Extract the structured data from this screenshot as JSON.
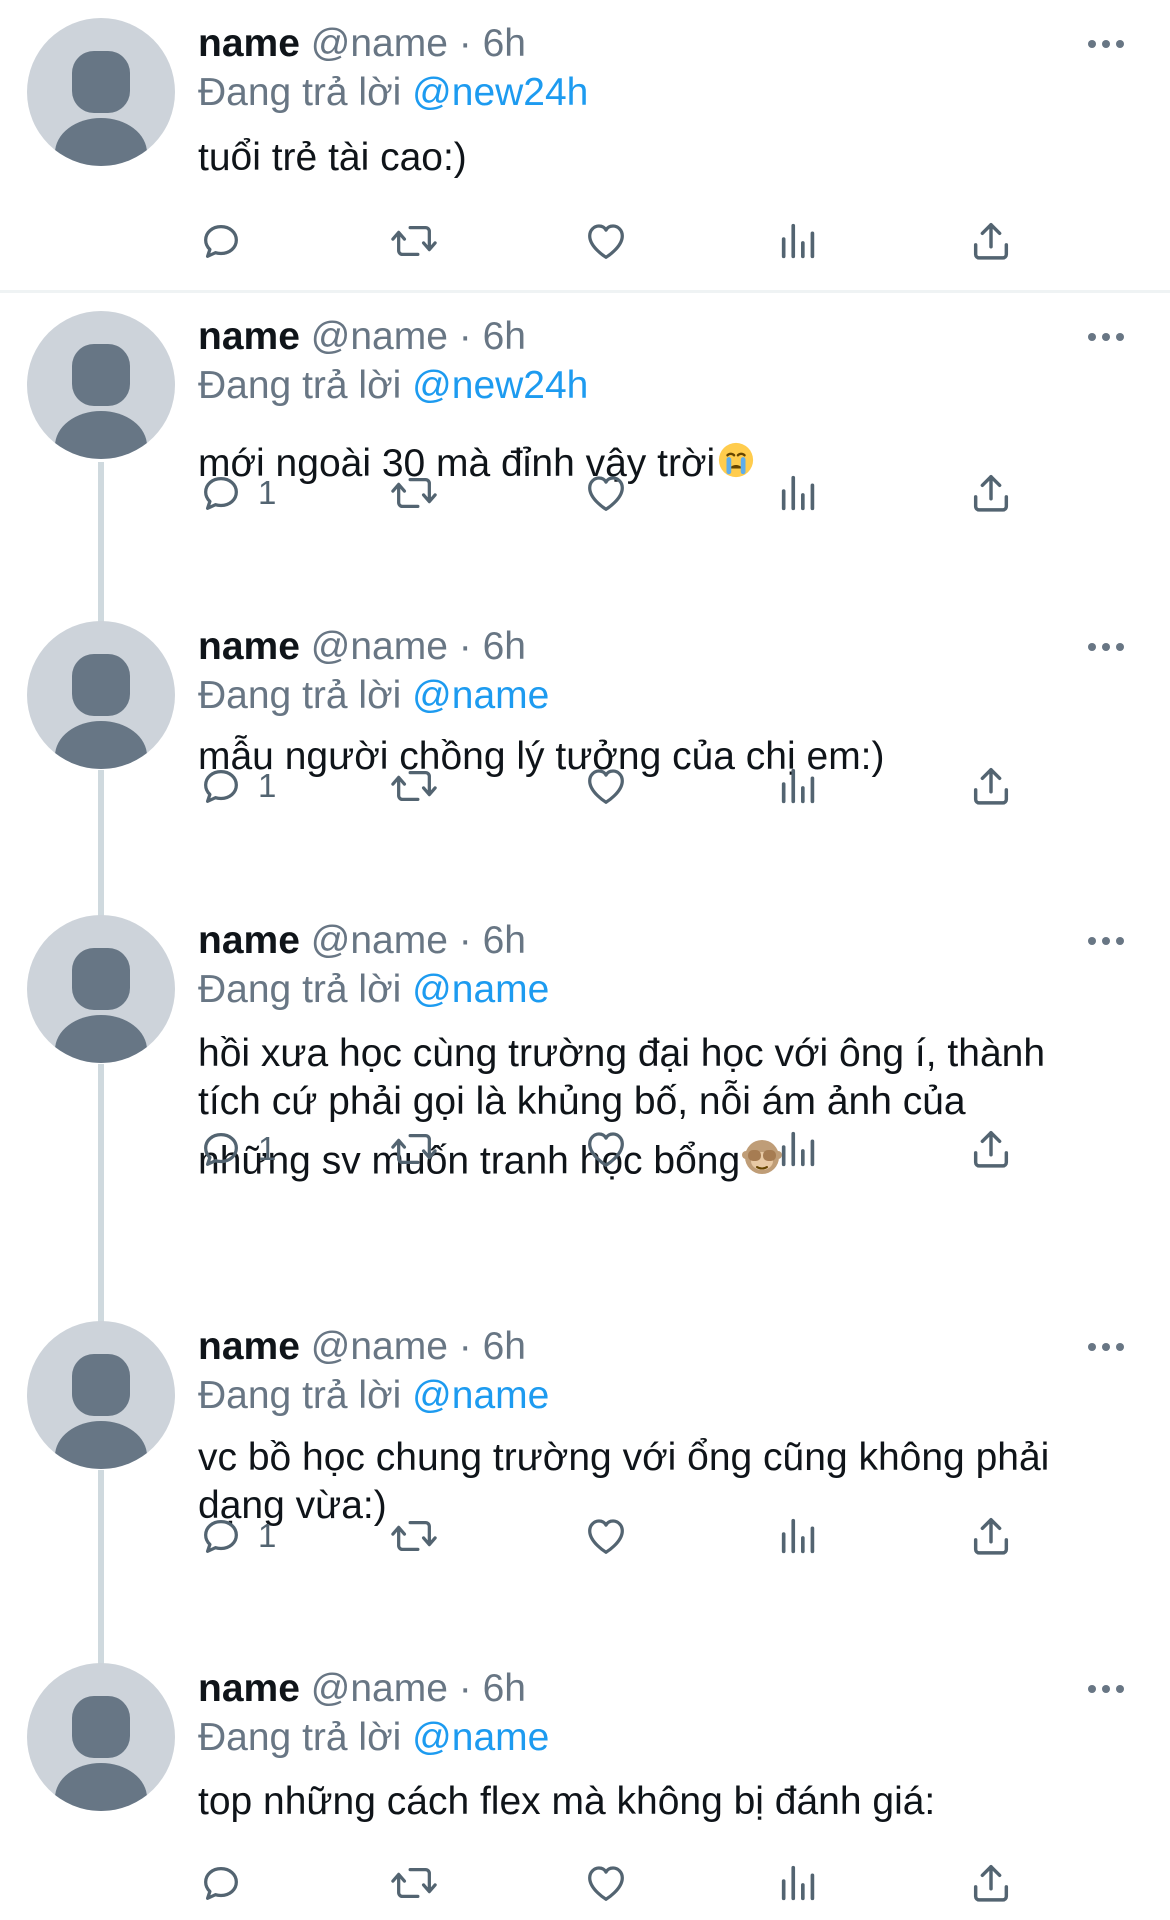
{
  "tweets": [
    {
      "author": "name",
      "handle": "@name",
      "separator": "·",
      "time": "6h",
      "reply_prefix": "Đang trả lời",
      "reply_to": "@new24h",
      "text_lines": [
        "tuổi trẻ tài cao:)"
      ],
      "emoji_icon": "",
      "reply_count": ""
    },
    {
      "author": "name",
      "handle": "@name",
      "separator": "·",
      "time": "6h",
      "reply_prefix": "Đang trả lời",
      "reply_to": "@new24h",
      "text_lines": [
        "mới ngoài 30 mà đỉnh vậy trời"
      ],
      "emoji_icon": "crying-face-emoji",
      "reply_count": "1"
    },
    {
      "author": "name",
      "handle": "@name",
      "separator": "·",
      "time": "6h",
      "reply_prefix": "Đang trả lời",
      "reply_to": "@name",
      "text_lines": [
        "mẫu người chồng lý tưởng của chị em:)"
      ],
      "emoji_icon": "",
      "reply_count": "1"
    },
    {
      "author": "name",
      "handle": "@name",
      "separator": "·",
      "time": "6h",
      "reply_prefix": "Đang trả lời",
      "reply_to": "@name",
      "text_lines": [
        "hồi xưa học cùng trường đại học với ông í, thành",
        "tích cứ phải gọi là khủng bố, nỗi ám ảnh của",
        "những sv muốn tranh học bổng"
      ],
      "emoji_icon": "see-no-evil-monkey-emoji",
      "reply_count": "1"
    },
    {
      "author": "name",
      "handle": "@name",
      "separator": "·",
      "time": "6h",
      "reply_prefix": "Đang trả lời",
      "reply_to": "@name",
      "text_lines": [
        "vc bồ học chung trường với ổng cũng không phải",
        "dạng vừa:)"
      ],
      "emoji_icon": "",
      "reply_count": "1"
    },
    {
      "author": "name",
      "handle": "@name",
      "separator": "·",
      "time": "6h",
      "reply_prefix": "Đang trả lời",
      "reply_to": "@name",
      "text_lines": [
        "top những cách flex mà không bị đánh giá:"
      ],
      "emoji_icon": "",
      "reply_count": ""
    }
  ],
  "icons": {
    "reply": "reply-bubble-icon",
    "retweet": "retweet-icon",
    "like": "heart-icon",
    "views": "views-bar-chart-icon",
    "share": "share-icon",
    "more": "more-dots-icon"
  },
  "colors": {
    "text": "#0f1419",
    "secondary": "#687684",
    "mention": "#1d9bf0",
    "avatar_bg": "#cdd3da",
    "avatar_fg": "#677685",
    "thread_line": "#cfd9de"
  }
}
